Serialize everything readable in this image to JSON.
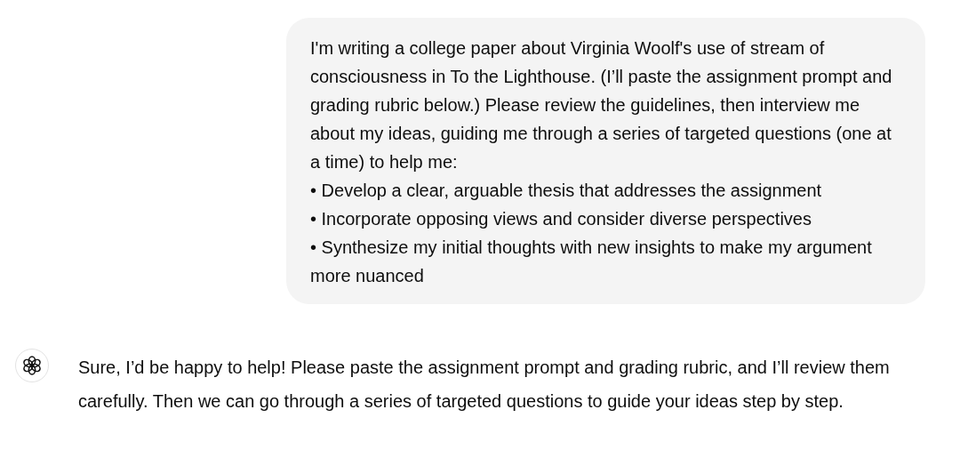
{
  "messages": [
    {
      "kind": "user",
      "paragraphs": [
        "I'm writing a college paper about Virginia Woolf's use of stream of consciousness in To the Lighthouse. (I’ll paste the assignment prompt and grading rubric below.) Please review the guidelines, then interview me about my ideas, guiding me through a series of targeted questions (one at a time) to help me:",
        "• Develop a clear, arguable thesis that addresses the assignment",
        "• Incorporate opposing views and consider diverse perspectives",
        "• Synthesize my initial thoughts with new insights to make my argument more nuanced"
      ]
    },
    {
      "kind": "assistant",
      "paragraphs": [
        "Sure, I’d be happy to help! Please paste the assignment prompt and grading rubric, and I’ll review them carefully. Then we can go through a series of targeted questions to guide your ideas step by step."
      ]
    }
  ]
}
